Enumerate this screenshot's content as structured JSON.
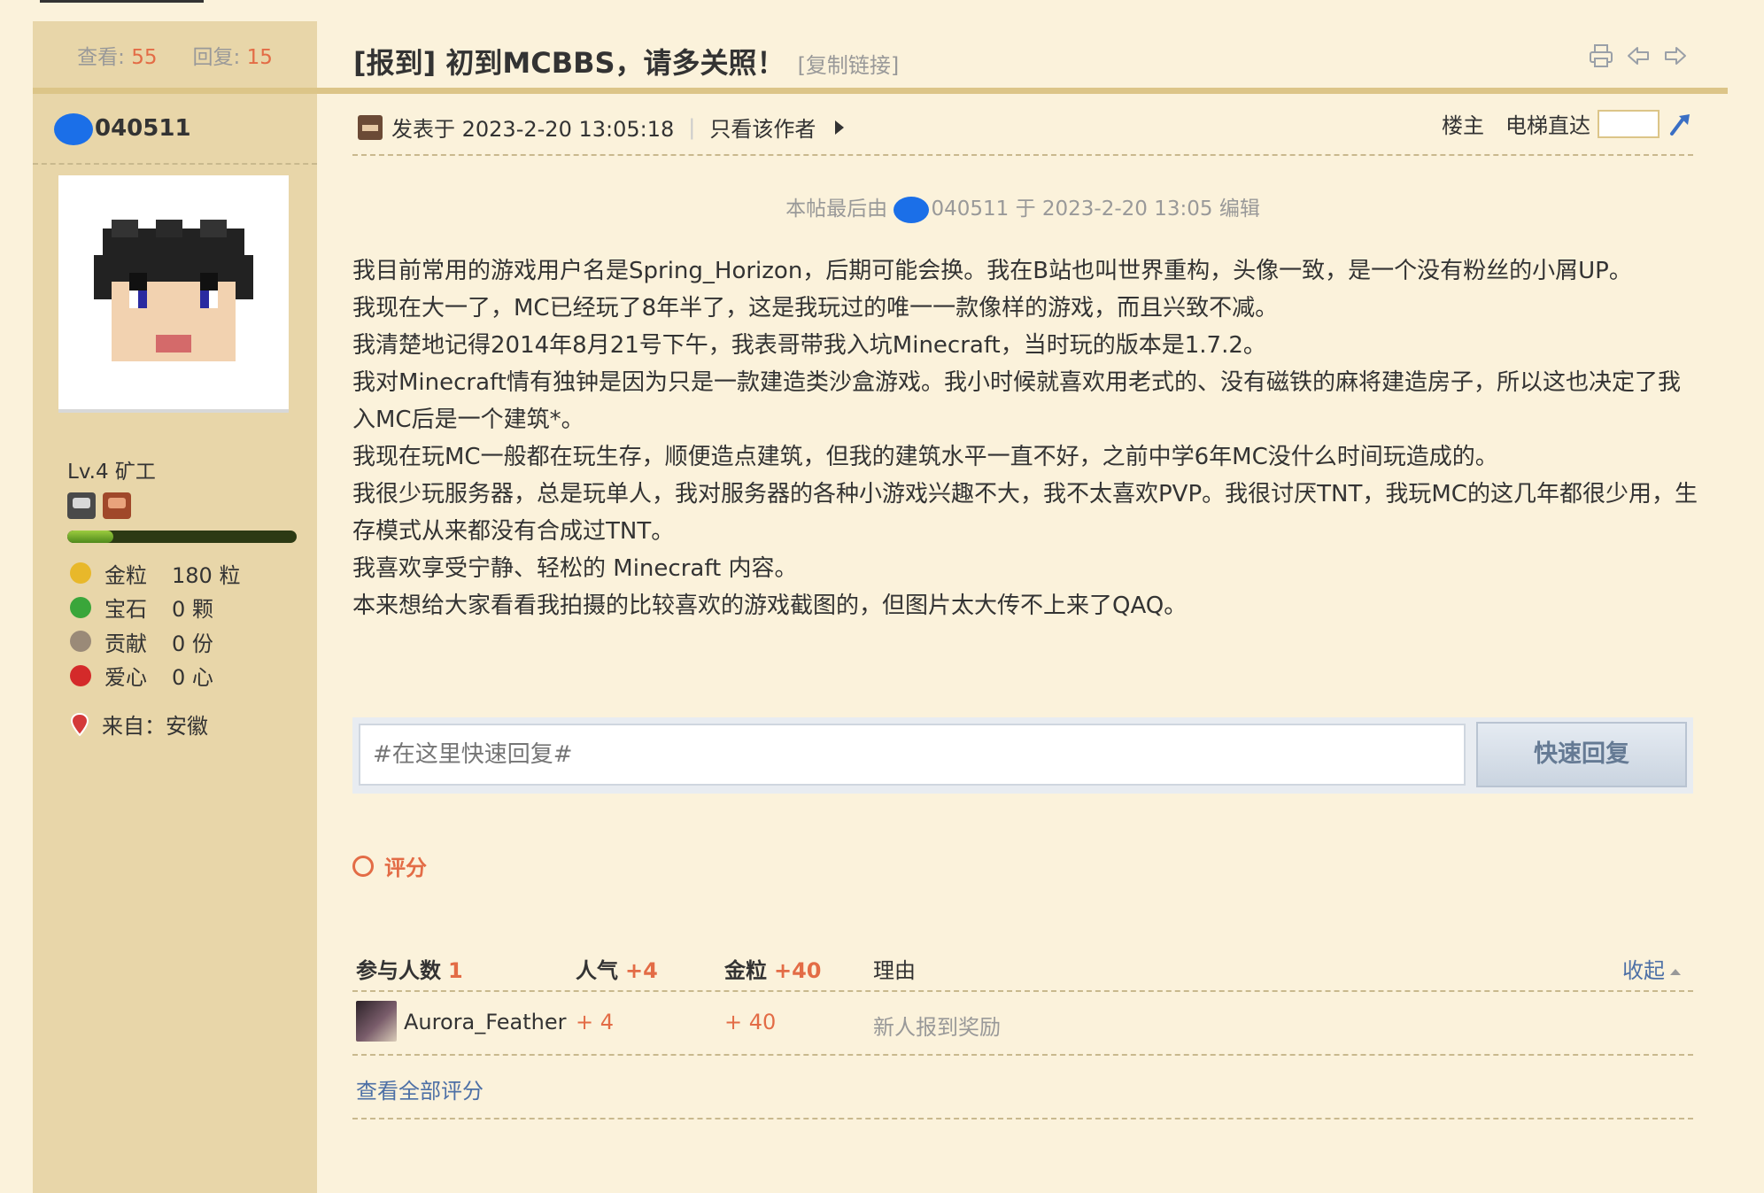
{
  "thread": {
    "views_label": "查看:",
    "views": "55",
    "replies_label": "回复:",
    "replies": "15",
    "title": "[报到] 初到MCBBS，请多关照！",
    "copy_link": "[复制链接]"
  },
  "author": {
    "name": "040511",
    "level": "Lv.4 矿工",
    "level_progress": 0.2,
    "stats": [
      {
        "label": "金粒",
        "value": "180 粒",
        "icon": "gold-nugget-icon",
        "color": "#e8b82a"
      },
      {
        "label": "宝石",
        "value": "0 颗",
        "icon": "gem-icon",
        "color": "#3aa63a"
      },
      {
        "label": "贡献",
        "value": "0 份",
        "icon": "contribution-icon",
        "color": "#9a8a78"
      },
      {
        "label": "爱心",
        "value": "0 心",
        "icon": "heart-apple-icon",
        "color": "#d42a2a"
      }
    ],
    "from": "来自：安徽"
  },
  "post": {
    "posted_at": "发表于 2023-2-20 13:05:18",
    "only_author": "只看该作者",
    "floor": "楼主",
    "elevator": "电梯直达",
    "edited_prefix": "本帖最后由",
    "edited_suffix": "040511 于 2023-2-20 13:05 编辑",
    "body": [
      "我目前常用的游戏用户名是Spring_Horizon，后期可能会换。我在B站也叫世界重构，头像一致，是一个没有粉丝的小屑UP。",
      "我现在大一了，MC已经玩了8年半了，这是我玩过的唯一一款像样的游戏，而且兴致不减。",
      "我清楚地记得2014年8月21号下午，我表哥带我入坑Minecraft，当时玩的版本是1.7.2。",
      "我对Minecraft情有独钟是因为只是一款建造类沙盒游戏。我小时候就喜欢用老式的、没有磁铁的麻将建造房子，所以这也决定了我入MC后是一个建筑*。",
      "我现在玩MC一般都在玩生存，顺便造点建筑，但我的建筑水平一直不好，之前中学6年MC没什么时间玩造成的。",
      "我很少玩服务器，总是玩单人，我对服务器的各种小游戏兴趣不大，我不太喜欢PVP。我很讨厌TNT，我玩MC的这几年都很少用，生存模式从来都没有合成过TNT。",
      "我喜欢享受宁静、轻松的 Minecraft 内容。",
      "本来想给大家看看我拍摄的比较喜欢的游戏截图的，但图片太大传不上来了QAQ。"
    ]
  },
  "quick_reply": {
    "placeholder": "#在这里快速回复#",
    "button": "快速回复"
  },
  "rating": {
    "title": "评分",
    "participants_label": "参与人数",
    "participants": "1",
    "popularity_label": "人气",
    "popularity_total": "+4",
    "gold_label": "金粒",
    "gold_total": "+40",
    "reason_label": "理由",
    "collapse": "收起",
    "rows": [
      {
        "user": "Aurora_Feather",
        "popularity": "+ 4",
        "gold": "+ 40",
        "reason": "新人报到奖励"
      }
    ],
    "view_all": "查看全部评分"
  },
  "colors": {
    "accent": "#e36c46",
    "link": "#4d70a6",
    "sidebar_bg": "#e8d6a9",
    "page_bg": "#fbf2db"
  }
}
